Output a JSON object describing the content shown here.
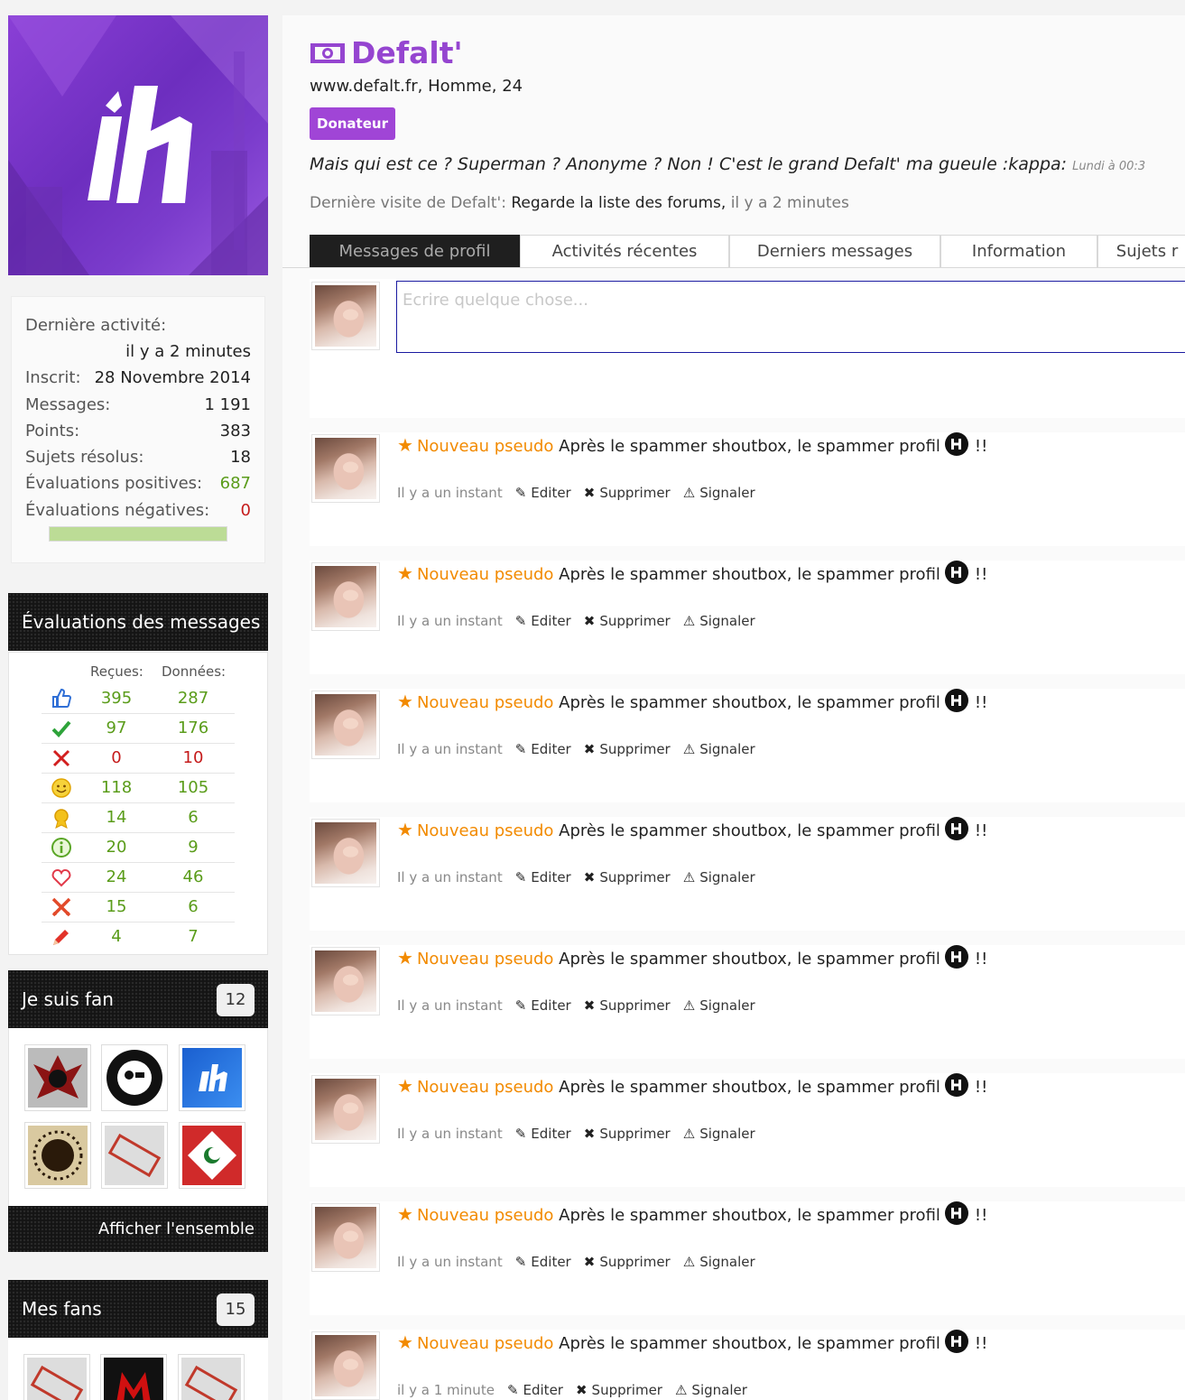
{
  "profile": {
    "name": "Defalt'",
    "subtitle": "www.defalt.fr, Homme, 24",
    "badge": "Donateur",
    "status": "Mais qui est ce ? Superman ? Anonyme ? Non ! C'est le grand Defalt' ma gueule :kappa:",
    "status_time": "Lundi à 00:3",
    "last_visit_label": "Dernière visite de Defalt':",
    "last_visit_link": "Regarde la liste des forums,",
    "last_visit_time": "il y a 2 minutes",
    "accent_color": "#9545d0"
  },
  "tabs": [
    "Messages de profil",
    "Activités récentes",
    "Derniers messages",
    "Information",
    "Sujets r"
  ],
  "stats": {
    "last_activity_label": "Dernière activité:",
    "last_activity_value": "il y a 2 minutes",
    "rows": [
      {
        "label": "Inscrit:",
        "value": "28 Novembre 2014"
      },
      {
        "label": "Messages:",
        "value": "1 191"
      },
      {
        "label": "Points:",
        "value": "383"
      },
      {
        "label": "Sujets résolus:",
        "value": "18"
      },
      {
        "label": "Évaluations positives:",
        "value": "687"
      },
      {
        "label": "Évaluations négatives:",
        "value": "0"
      }
    ],
    "rating_fraction": 1.0
  },
  "evaluations": {
    "title": "Évaluations des messages",
    "col_received": "Reçues:",
    "col_given": "Données:",
    "rows": [
      {
        "icon": "thumbs-up-icon",
        "received": "395",
        "given": "287"
      },
      {
        "icon": "check-icon",
        "received": "97",
        "given": "176"
      },
      {
        "icon": "cross-icon",
        "received": "0",
        "given": "10"
      },
      {
        "icon": "smiley-icon",
        "received": "118",
        "given": "105"
      },
      {
        "icon": "award-icon",
        "received": "14",
        "given": "6"
      },
      {
        "icon": "info-icon",
        "received": "20",
        "given": "9"
      },
      {
        "icon": "heart-icon",
        "received": "24",
        "given": "46"
      },
      {
        "icon": "crossed-swords-icon",
        "received": "15",
        "given": "6"
      },
      {
        "icon": "pencil-icon",
        "received": "4",
        "given": "7"
      }
    ]
  },
  "fan_of": {
    "title": "Je suis fan",
    "count": "12",
    "show_all": "Afficher l'ensemble"
  },
  "my_fans": {
    "title": "Mes fans",
    "count": "15"
  },
  "composer": {
    "placeholder": "Ecrire quelque chose..."
  },
  "posts": [
    {
      "author": "Nouveau pseudo",
      "text": "Après le spammer shoutbox, le spammer profil",
      "suffix": "!!",
      "time": "Il y a un instant",
      "edit": "Editer",
      "delete": "Supprimer",
      "report": "Signaler"
    },
    {
      "author": "Nouveau pseudo",
      "text": "Après le spammer shoutbox, le spammer profil",
      "suffix": "!!",
      "time": "Il y a un instant",
      "edit": "Editer",
      "delete": "Supprimer",
      "report": "Signaler"
    },
    {
      "author": "Nouveau pseudo",
      "text": "Après le spammer shoutbox, le spammer profil",
      "suffix": "!!",
      "time": "Il y a un instant",
      "edit": "Editer",
      "delete": "Supprimer",
      "report": "Signaler"
    },
    {
      "author": "Nouveau pseudo",
      "text": "Après le spammer shoutbox, le spammer profil",
      "suffix": "!!",
      "time": "Il y a un instant",
      "edit": "Editer",
      "delete": "Supprimer",
      "report": "Signaler"
    },
    {
      "author": "Nouveau pseudo",
      "text": "Après le spammer shoutbox, le spammer profil",
      "suffix": "!!",
      "time": "Il y a un instant",
      "edit": "Editer",
      "delete": "Supprimer",
      "report": "Signaler"
    },
    {
      "author": "Nouveau pseudo",
      "text": "Après le spammer shoutbox, le spammer profil",
      "suffix": "!!",
      "time": "Il y a un instant",
      "edit": "Editer",
      "delete": "Supprimer",
      "report": "Signaler"
    },
    {
      "author": "Nouveau pseudo",
      "text": "Après le spammer shoutbox, le spammer profil",
      "suffix": "!!",
      "time": "Il y a un instant",
      "edit": "Editer",
      "delete": "Supprimer",
      "report": "Signaler"
    },
    {
      "author": "Nouveau pseudo",
      "text": "Après le spammer shoutbox, le spammer profil",
      "suffix": "!!",
      "time": "il y a 1 minute",
      "edit": "Editer",
      "delete": "Supprimer",
      "report": "Signaler"
    }
  ]
}
